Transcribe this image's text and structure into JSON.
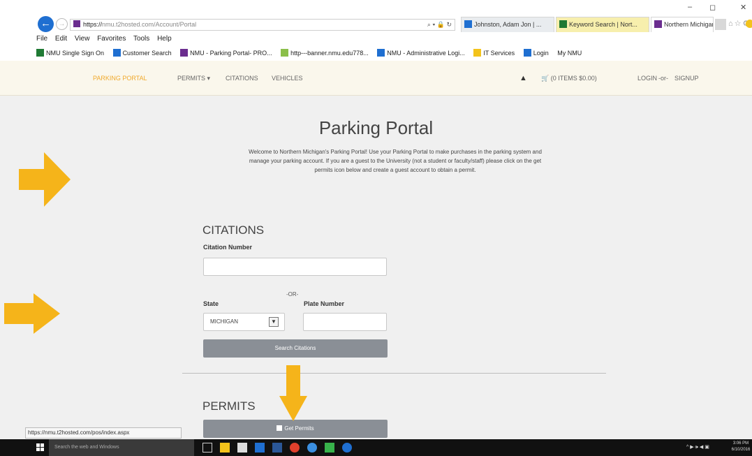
{
  "browser": {
    "url_prefix": "https://",
    "url_host": "nmu.t2hosted.com/Account/Portal",
    "address_controls": "⌕ ▾ 🔒 ↻",
    "tabs": [
      {
        "label": "Johnston, Adam Jon | ...",
        "color": "#1f6fd1"
      },
      {
        "label": "Keyword Search | Nort...",
        "color": "#1f7a34"
      },
      {
        "label": "Northern Michigan...",
        "color": "#6b2d8f"
      }
    ],
    "menu": [
      "File",
      "Edit",
      "View",
      "Favorites",
      "Tools",
      "Help"
    ],
    "favorites": [
      {
        "label": "NMU Single Sign On",
        "color": "#1f7a34"
      },
      {
        "label": "Customer Search",
        "color": "#1f6fd1"
      },
      {
        "label": "NMU - Parking Portal- PRO...",
        "color": "#6b2d8f"
      },
      {
        "label": "http---banner.nmu.edu778...",
        "color": "#8bbf4a"
      },
      {
        "label": "NMU - Administrative Logi...",
        "color": "#1f6fd1"
      },
      {
        "label": "IT Services",
        "color": "#f3c31b"
      },
      {
        "label": "Login",
        "color": "#1f6fd1"
      },
      {
        "label": "My NMU",
        "color": "#999999"
      }
    ],
    "status_url": "https://nmu.t2hosted.com/pos/index.aspx"
  },
  "nav": {
    "brand": "PARKING PORTAL",
    "permits": "PERMITS ▾",
    "citations": "CITATIONS",
    "vehicles": "VEHICLES",
    "bell": "▲",
    "cart": "🛒 (0 ITEMS $0.00)",
    "login": "LOGIN",
    "or": "-or-",
    "signup": "SIGNUP"
  },
  "main": {
    "title": "Parking Portal",
    "intro": "Welcome to Northern Michigan's Parking Portal! Use your Parking Portal to make purchases in the parking system and manage your parking account. If you are a guest to the University (not a student or faculty/staff) please click on the get permits icon below and create a guest account to obtain a permit.",
    "citations": {
      "heading": "CITATIONS",
      "citation_label": "Citation Number",
      "or_text": "-OR-",
      "state_label": "State",
      "state_value": "MICHIGAN",
      "plate_label": "Plate Number",
      "search_button": "Search Citations"
    },
    "permits": {
      "heading": "PERMITS",
      "get_button": "Get Permits"
    }
  },
  "taskbar": {
    "search_placeholder": "Search the web and Windows",
    "tray": "^ ▶ 🕪 ◀ ▣",
    "time": "3:06 PM",
    "date": "6/10/2016"
  },
  "colors": {
    "arrow": "#f5b41a",
    "brand": "#f0a92c",
    "button": "#8a8f96"
  }
}
